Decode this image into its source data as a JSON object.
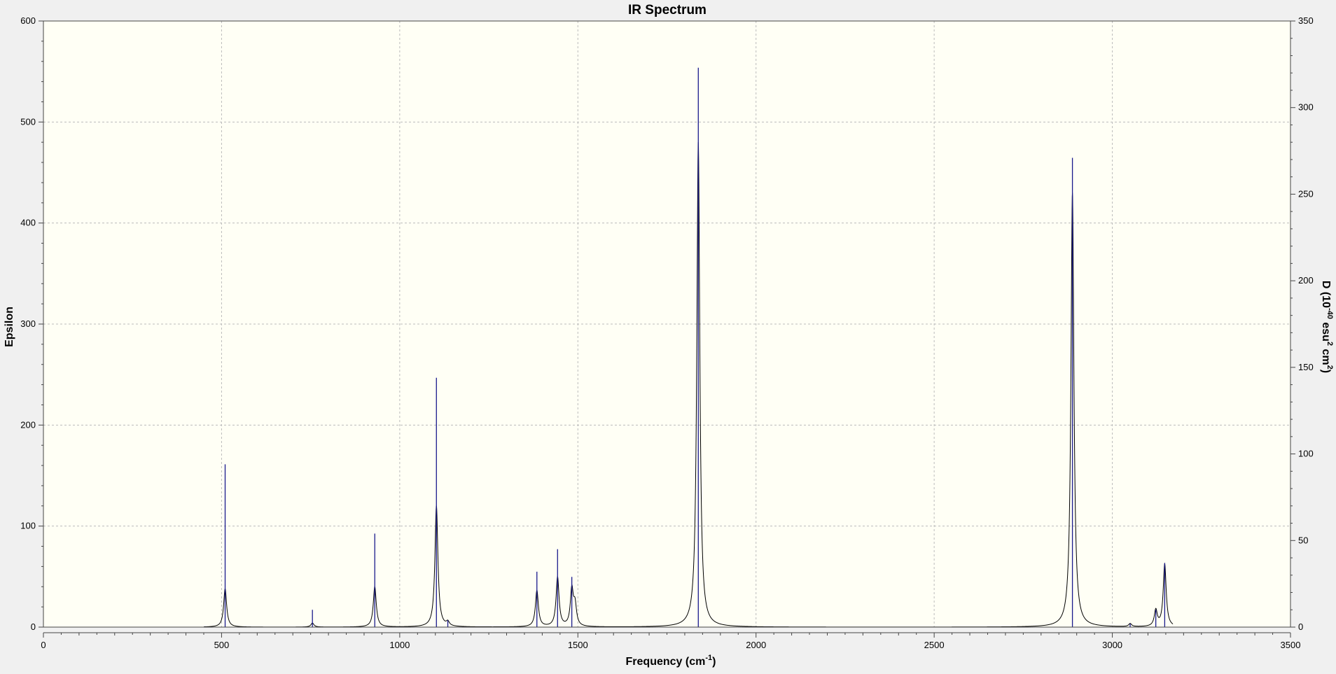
{
  "chart_data": {
    "type": "line",
    "title": "IR Spectrum",
    "xlabel": "Frequency (cm",
    "xlabel_sup": "-1",
    "xlabel_end": ")",
    "ylabel": "Epsilon",
    "y2label_parts": [
      "D (10",
      "-40",
      " esu",
      "2",
      " cm",
      "2",
      ")"
    ],
    "xlim": [
      0,
      3500
    ],
    "ylim": [
      0,
      600
    ],
    "y2lim": [
      0,
      350
    ],
    "x_ticks": [
      0,
      500,
      1000,
      1500,
      2000,
      2500,
      3000,
      3500
    ],
    "y_ticks": [
      0,
      100,
      200,
      300,
      400,
      500,
      600
    ],
    "y2_ticks": [
      0,
      50,
      100,
      150,
      200,
      250,
      300,
      350
    ],
    "grid": true,
    "legend": "none",
    "colors": {
      "plot_background": "#fffff5",
      "spectrum_line": "#000000",
      "stick_line": "#1a1a8c",
      "grid_line": "#bbbbbb",
      "axis_line": "#444444",
      "window_background": "#f0f0f0"
    },
    "series": [
      {
        "kind": "spectrum",
        "peaks": [
          {
            "x": 510,
            "y": 38
          },
          {
            "x": 755,
            "y": 4
          },
          {
            "x": 930,
            "y": 40
          },
          {
            "x": 1103,
            "y": 120
          },
          {
            "x": 1135,
            "y": 4
          },
          {
            "x": 1385,
            "y": 36
          },
          {
            "x": 1443,
            "y": 49
          },
          {
            "x": 1483,
            "y": 36
          },
          {
            "x": 1492,
            "y": 20
          },
          {
            "x": 1838,
            "y": 480
          },
          {
            "x": 2888,
            "y": 430
          },
          {
            "x": 3050,
            "y": 3
          },
          {
            "x": 3122,
            "y": 16
          },
          {
            "x": 3147,
            "y": 62
          }
        ],
        "lineshape_hwhm": 5
      },
      {
        "kind": "sticks",
        "axis": "right",
        "sticks": [
          {
            "x": 510,
            "d": 94
          },
          {
            "x": 755,
            "d": 10
          },
          {
            "x": 930,
            "d": 54
          },
          {
            "x": 1103,
            "d": 144
          },
          {
            "x": 1135,
            "d": 4
          },
          {
            "x": 1385,
            "d": 32
          },
          {
            "x": 1443,
            "d": 45
          },
          {
            "x": 1483,
            "d": 29
          },
          {
            "x": 1838,
            "d": 323
          },
          {
            "x": 2888,
            "d": 271
          },
          {
            "x": 3050,
            "d": 2
          },
          {
            "x": 3122,
            "d": 10
          },
          {
            "x": 3147,
            "d": 37
          }
        ]
      }
    ]
  }
}
